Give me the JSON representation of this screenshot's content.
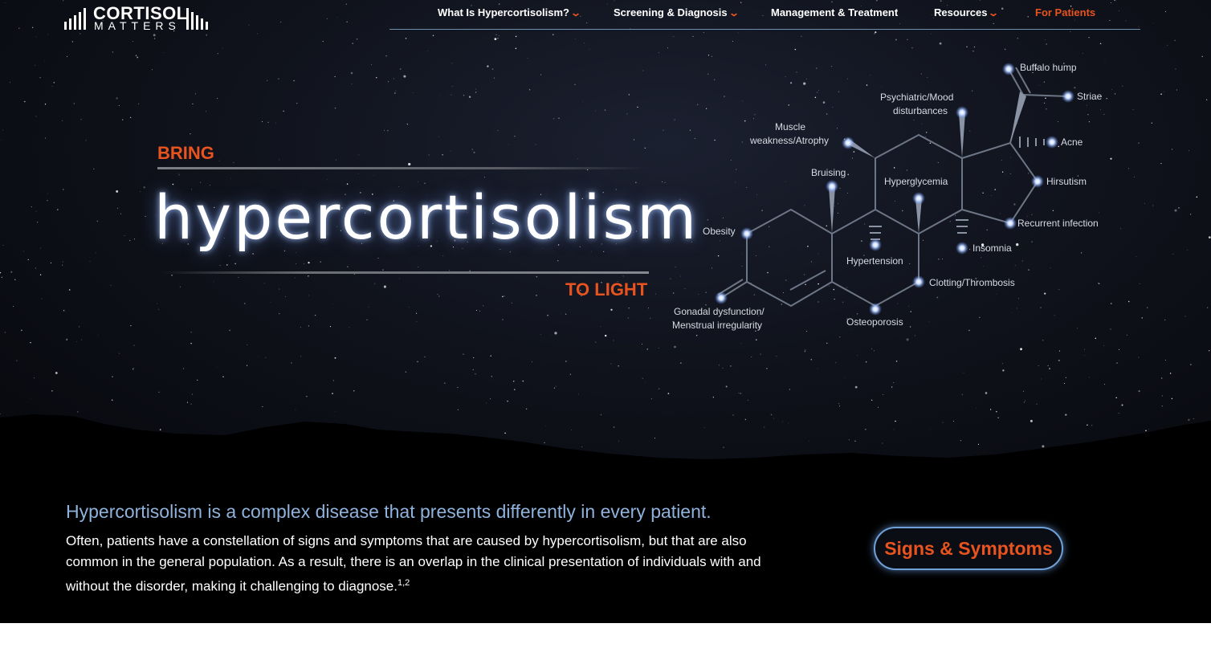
{
  "brand": {
    "top": "CORTISOL",
    "bottom": "MATTERS"
  },
  "nav": {
    "items": [
      {
        "label": "What Is Hypercortisolism?",
        "has_dropdown": true
      },
      {
        "label": "Screening & Diagnosis",
        "has_dropdown": true
      },
      {
        "label": "Management & Treatment",
        "has_dropdown": false
      },
      {
        "label": "Resources",
        "has_dropdown": true
      },
      {
        "label": "For Patients",
        "has_dropdown": false
      }
    ],
    "dropdown_icon": "chevron-down-icon"
  },
  "hero": {
    "kicker_top": "BRING",
    "headline": "hypercortisolism",
    "kicker_bottom": "TO LIGHT"
  },
  "constellation": {
    "labels": {
      "buffalo_hump": "Buffalo hump",
      "striae": "Striae",
      "psychiatric": "Psychiatric/Mood",
      "psychiatric2": "disturbances",
      "acne": "Acne",
      "muscle": "Muscle",
      "muscle2": "weakness/Atrophy",
      "bruising": "Bruising",
      "hyperglycemia": "Hyperglycemia",
      "hirsutism": "Hirsutism",
      "recurrent": "Recurrent infection",
      "obesity": "Obesity",
      "insomnia": "Insomnia",
      "hypertension": "Hypertension",
      "clotting": "Clotting/Thrombosis",
      "gonadal": "Gonadal dysfunction/",
      "gonadal2": "Menstrual irregularity",
      "osteoporosis": "Osteoporosis"
    }
  },
  "content": {
    "lead": "Hypercortisolism is a complex disease that presents differently in every patient.",
    "body": "Often, patients have a constellation of signs and symptoms that are caused by hypercortisolism, but that are also common in the general population. As a result, there is an overlap in the clinical presentation of individuals with and without the disorder, making it challenging to diagnose.",
    "refs": "1,2",
    "cta": "Signs & Symptoms"
  },
  "colors": {
    "accent": "#e8531f",
    "lead_text": "#8fb2dc",
    "cta_border": "#6fa0d8",
    "background": "#000000"
  }
}
